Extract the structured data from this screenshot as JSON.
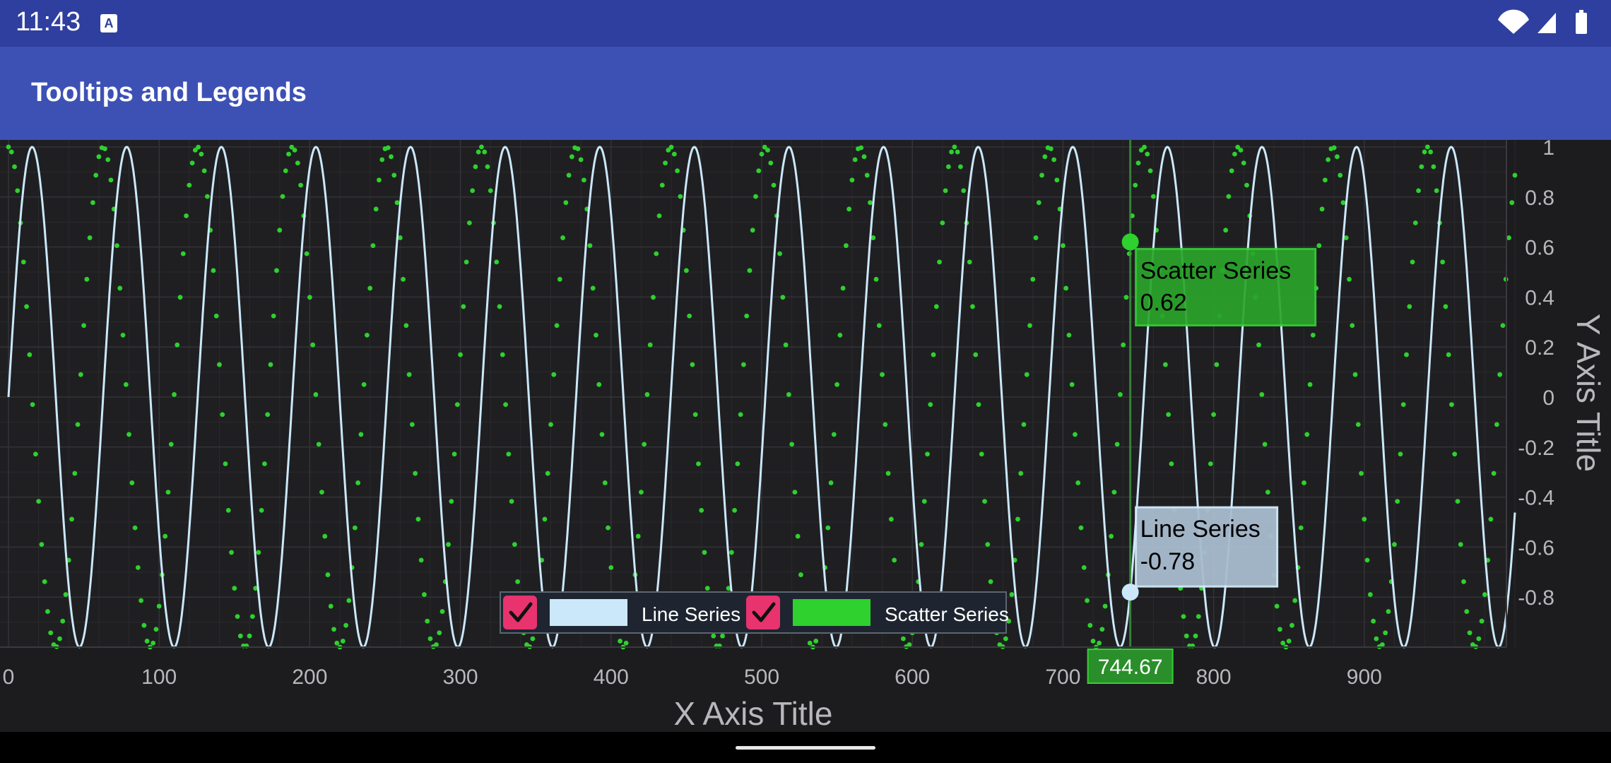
{
  "status_bar": {
    "time": "11:43",
    "notification_icon": "text-a-icon",
    "notification_glyph": "A",
    "icons": [
      "wifi-icon",
      "cellular-signal-icon",
      "battery-icon"
    ]
  },
  "app_bar": {
    "title": "Tooltips and Legends"
  },
  "colors": {
    "status_bar": "#2f3fa0",
    "app_bar": "#3d51b5",
    "chart_background": "#1c1c1e",
    "line_series": "#cbe8fb",
    "scatter_series": "#2ed12e",
    "checkbox": "#e8336f"
  },
  "chart_data": {
    "type": "line",
    "xlabel": "X Axis Title",
    "ylabel": "Y Axis Title",
    "xlim": [
      0,
      1000
    ],
    "ylim": [
      -1,
      1
    ],
    "x_ticks": [
      "0",
      "100",
      "200",
      "300",
      "400",
      "500",
      "600",
      "700",
      "800",
      "900"
    ],
    "x_tick_values": [
      0,
      100,
      200,
      300,
      400,
      500,
      600,
      700,
      800,
      900
    ],
    "y_ticks": [
      "1",
      "0.8",
      "0.6",
      "0.4",
      "0.2",
      "0",
      "-0.2",
      "-0.4",
      "-0.6",
      "-0.8"
    ],
    "y_tick_values": [
      1,
      0.8,
      0.6,
      0.4,
      0.2,
      0,
      -0.2,
      -0.4,
      -0.6,
      -0.8
    ],
    "grid": true,
    "series": [
      {
        "name": "Line Series",
        "kind": "line",
        "function": "sine",
        "period": 62.8,
        "phase": 0,
        "amplitude": 1,
        "x_range": [
          0,
          1000
        ]
      },
      {
        "name": "Scatter Series",
        "kind": "scatter",
        "function": "cosine",
        "period": 62.8,
        "phase": 0,
        "amplitude": 1,
        "x_range": [
          0,
          1000
        ],
        "point_spacing": 2
      }
    ],
    "cursor": {
      "x": 744.67,
      "x_label": "744.67",
      "tooltips": [
        {
          "series": "Scatter Series",
          "value": "0.62",
          "y": 0.62
        },
        {
          "series": "Line Series",
          "value": "-0.78",
          "y": -0.78
        }
      ]
    },
    "legend": {
      "placement": "bottom-center",
      "items": [
        {
          "label": "Line Series",
          "checked": true
        },
        {
          "label": "Scatter Series",
          "checked": true
        }
      ]
    }
  }
}
